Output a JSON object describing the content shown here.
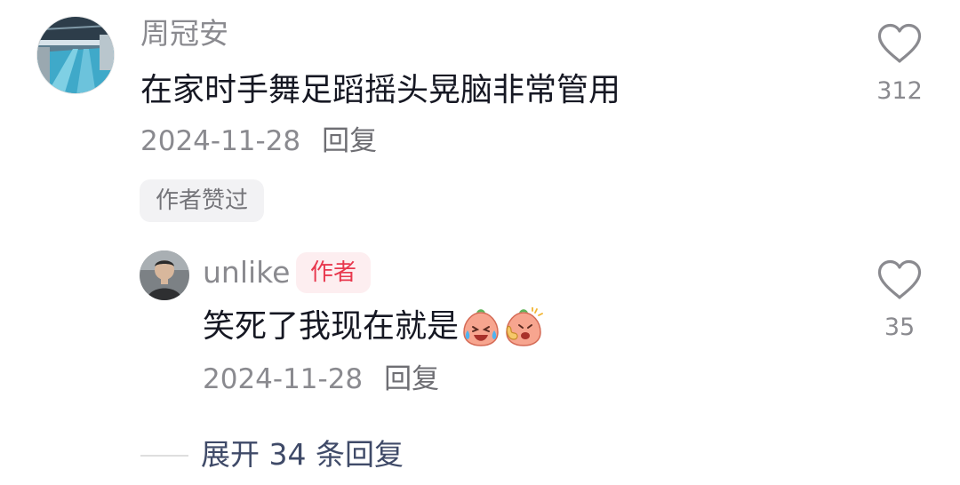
{
  "main_comment": {
    "avatar": "pool-photo-avatar",
    "username": "周冠安",
    "text": "在家时手舞足蹈摇头晃脑非常管用",
    "date": "2024-11-28",
    "reply_label": "回复",
    "liked_tag": "作者赞过",
    "like_icon": "heart-icon",
    "like_count": "312"
  },
  "reply": {
    "avatar": "person-photo-avatar",
    "username": "unlike",
    "author_badge": "作者",
    "text": "笑死了我现在就是",
    "emojis": [
      "laughing-tears-emoji",
      "thumbs-up-emoji"
    ],
    "date": "2024-11-28",
    "reply_label": "回复",
    "like_icon": "heart-icon",
    "like_count": "35"
  },
  "expand": {
    "label": "展开 34 条回复"
  },
  "colors": {
    "username": "#8a8a8f",
    "text": "#161823",
    "author_badge_bg": "#fdeef0",
    "author_badge_text": "#e8384e",
    "expand_text": "#3f4a68"
  }
}
